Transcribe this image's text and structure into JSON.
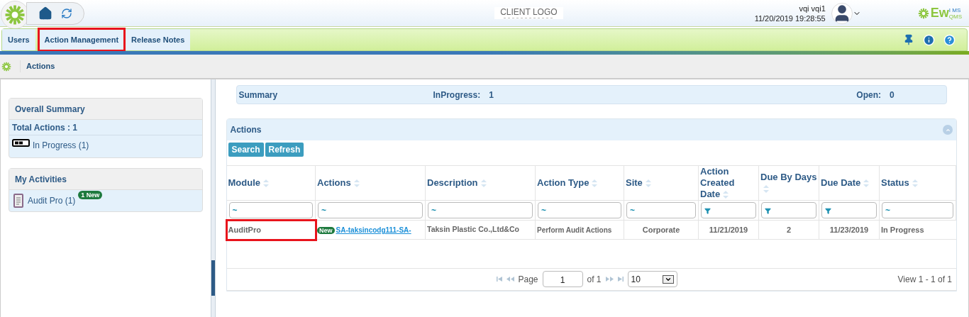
{
  "header": {
    "client_logo": "CLIENT LOGO",
    "user_name": "vqi vqi1",
    "datetime": "11/20/2019 19:28:55",
    "brand": {
      "main": "Ew",
      "top": "I MS",
      "bottom": "QMS"
    }
  },
  "tabs": [
    {
      "label": "Users",
      "highlighted": false
    },
    {
      "label": "Action Management",
      "highlighted": true
    },
    {
      "label": "Release Notes",
      "highlighted": false
    }
  ],
  "breadcrumb": "Actions",
  "overall_summary": {
    "title": "Overall Summary",
    "total": "Total Actions : 1",
    "items": [
      {
        "label": "In Progress (1)"
      }
    ]
  },
  "my_activities": {
    "title": "My Activities",
    "items": [
      {
        "label": "Audit Pro (1)",
        "badge": "1 New"
      }
    ]
  },
  "summary_bar": [
    {
      "label": "Summary"
    },
    {
      "label": "InProgress:",
      "value": "1"
    },
    {
      "label": "Open:",
      "value": "0"
    }
  ],
  "actions_panel": {
    "title": "Actions",
    "buttons": [
      "Search",
      "Refresh"
    ],
    "columns": [
      {
        "label": "Module",
        "filter": {
          "kind": "text",
          "mark": "~"
        }
      },
      {
        "label": "Actions",
        "filter": {
          "kind": "text",
          "mark": "~"
        }
      },
      {
        "label": "Description",
        "filter": {
          "kind": "text",
          "mark": "~"
        }
      },
      {
        "label": "Action Type",
        "filter": {
          "kind": "text",
          "mark": "~"
        }
      },
      {
        "label": "Site",
        "filter": {
          "kind": "text",
          "mark": "~"
        }
      },
      {
        "label": "Action Created Date",
        "filter": {
          "kind": "date"
        }
      },
      {
        "label": "Due By Days",
        "filter": {
          "kind": "date"
        }
      },
      {
        "label": "Due Date",
        "filter": {
          "kind": "date"
        }
      },
      {
        "label": "Status",
        "filter": {
          "kind": "text",
          "mark": "~"
        }
      }
    ],
    "rows": [
      {
        "module": "AuditPro",
        "module_highlighted": true,
        "badge": "New",
        "action": "SA-taksincodg111-SA-",
        "description": "Taksin Plastic Co.,Ltd&Co",
        "action_type": "Perform Audit Actions",
        "site": "Corporate",
        "created": "11/21/2019",
        "due_by_days": "2",
        "due_date": "11/23/2019",
        "status": "In Progress"
      }
    ],
    "pager": {
      "page_label": "Page",
      "page": "1",
      "of": "of 1",
      "page_size": "10",
      "view": "View 1 - 1 of 1"
    }
  }
}
